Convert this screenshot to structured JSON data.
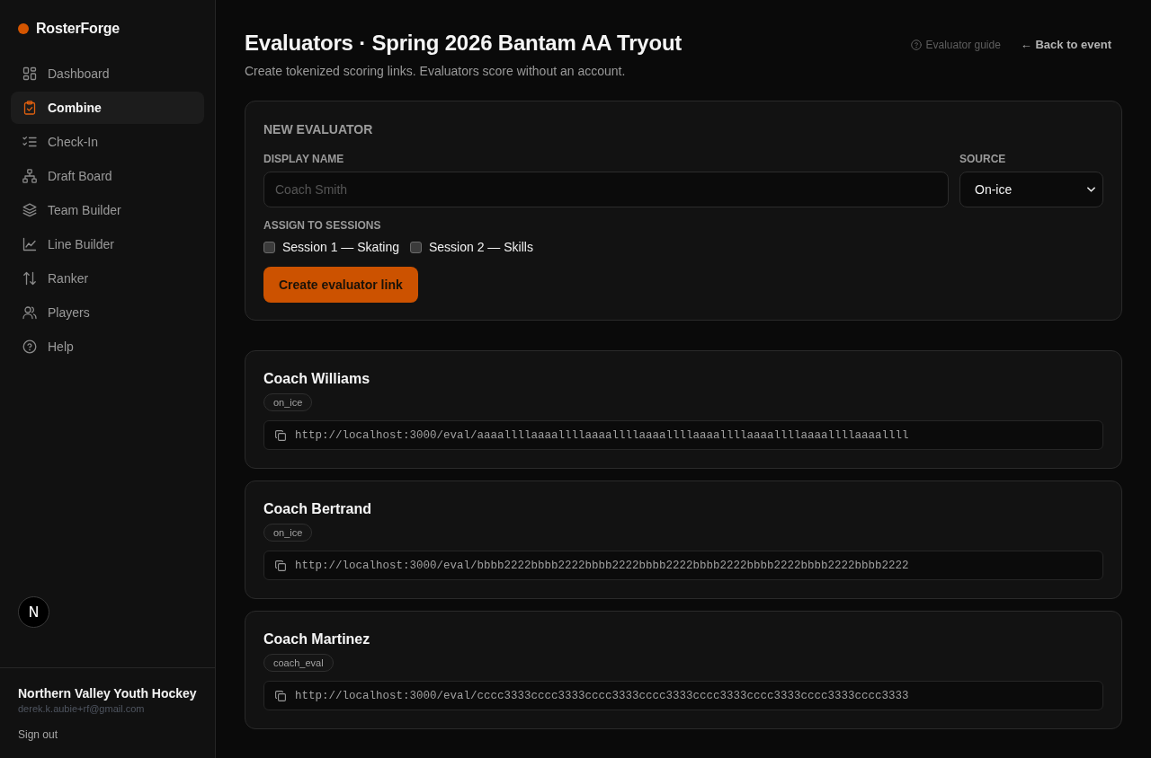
{
  "sidebar": {
    "brand": "RosterForge",
    "items": [
      {
        "label": "Dashboard",
        "selected": false
      },
      {
        "label": "Combine",
        "selected": true
      },
      {
        "label": "Check-In",
        "selected": false
      },
      {
        "label": "Draft Board",
        "selected": false
      },
      {
        "label": "Team Builder",
        "selected": false
      },
      {
        "label": "Line Builder",
        "selected": false
      },
      {
        "label": "Ranker",
        "selected": false
      },
      {
        "label": "Players",
        "selected": false
      },
      {
        "label": "Help",
        "selected": false
      }
    ],
    "dev_badge": "N",
    "account": {
      "org": "Northern Valley Youth Hockey",
      "email": "derek.k.aubie+rf@gmail.com",
      "sign_out": "Sign out"
    }
  },
  "header": {
    "title": "Evaluators · Spring 2026 Bantam AA Tryout",
    "subtitle": "Create tokenized scoring links. Evaluators score without an account.",
    "guide_link": "Evaluator guide",
    "back_link": "← Back to event"
  },
  "new_evaluator": {
    "heading": "NEW EVALUATOR",
    "display_name": {
      "label": "DISPLAY NAME",
      "placeholder": "Coach Smith"
    },
    "source": {
      "label": "SOURCE",
      "value": "On-ice"
    },
    "sessions": {
      "label": "ASSIGN TO SESSIONS",
      "options": [
        {
          "label": "Session 1 — Skating",
          "checked": false
        },
        {
          "label": "Session 2 — Skills",
          "checked": false
        }
      ]
    },
    "button": "Create evaluator link"
  },
  "evaluators": [
    {
      "name": "Coach Williams",
      "tag": "on_ice",
      "link": "http://localhost:3000/eval/aaaallllaaaallllaaaallllaaaallllaaaallllaaaallllaaaallllaaaallll"
    },
    {
      "name": "Coach Bertrand",
      "tag": "on_ice",
      "link": "http://localhost:3000/eval/bbbb2222bbbb2222bbbb2222bbbb2222bbbb2222bbbb2222bbbb2222bbbb2222"
    },
    {
      "name": "Coach Martinez",
      "tag": "coach_eval",
      "link": "http://localhost:3000/eval/cccc3333cccc3333cccc3333cccc3333cccc3333cccc3333cccc3333cccc3333"
    }
  ]
}
